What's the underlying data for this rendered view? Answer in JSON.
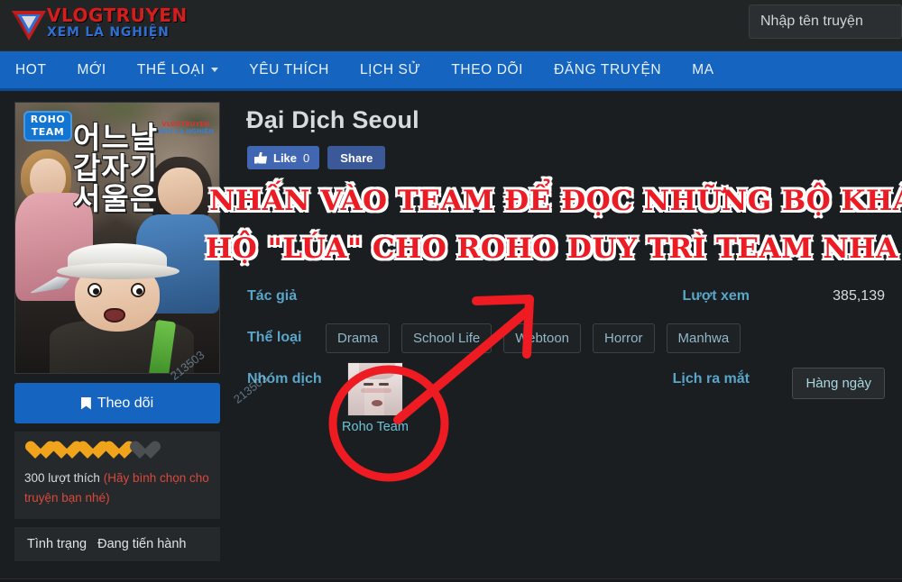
{
  "header": {
    "logo": {
      "line1": "VLOGTRUYEN",
      "line2": "XEM LÀ NGHIỆN",
      "icon": "triangle-play-logo-icon"
    },
    "search": {
      "placeholder": "Nhập tên truyện",
      "value": ""
    }
  },
  "nav": {
    "items": [
      {
        "label": "HOT",
        "has_caret": false
      },
      {
        "label": "MỚI",
        "has_caret": false
      },
      {
        "label": "THỂ LOẠI",
        "has_caret": true
      },
      {
        "label": "YÊU THÍCH",
        "has_caret": false
      },
      {
        "label": "LỊCH SỬ",
        "has_caret": false
      },
      {
        "label": "THEO DÕI",
        "has_caret": false
      },
      {
        "label": "ĐĂNG TRUYỆN",
        "has_caret": false
      },
      {
        "label": "MA",
        "has_caret": false
      }
    ]
  },
  "cover": {
    "team_badge_line1": "ROHO",
    "team_badge_line2": "TEAM",
    "korean_title": "어느날 갑자기 서울은",
    "watermark_line1": "VLOGTRUYEN",
    "watermark_line2": "XEM LÀ NGHIỆN"
  },
  "sidebar": {
    "follow_label": "Theo dõi",
    "follow_icon": "bookmark-icon",
    "hearts_filled": 4,
    "hearts_total": 5,
    "likes_text": "300 lượt thích",
    "likes_note": "(Hãy bình chọn cho truyện bạn nhé)",
    "status_label": "Tình trạng",
    "status_value": "Đang tiến hành"
  },
  "main": {
    "title": "Đại Dịch Seoul",
    "social": {
      "like_label": "Like",
      "like_count": "0",
      "share_label": "Share",
      "like_icon": "thumbs-up-icon"
    },
    "info": {
      "author_label": "Tác giả",
      "author_value": "",
      "views_label": "Lượt xem",
      "views_value": "385,139",
      "genres_label": "Thể loại",
      "genres": [
        "Drama",
        "School Life",
        "Webtoon",
        "Horror",
        "Manhwa"
      ],
      "team_label": "Nhóm dịch",
      "team_name": "Roho Team",
      "schedule_label": "Lịch ra mắt",
      "schedule_value": "Hàng ngày"
    }
  },
  "annotation": {
    "line1": "NHẤN VÀO TEAM ĐỂ ĐỌC NHỮNG BỘ KHÁC ỦNG",
    "line2": "HỘ \"LÚA\" CHO ROHO DUY TRÌ TEAM NHA CẢ NHÀ!!",
    "color": "#ec1c24",
    "shapes": [
      "circle-highlight",
      "arrow-pointer"
    ]
  },
  "watermarks": {
    "w1": "213503",
    "w2": "213503"
  },
  "colors": {
    "nav_blue": "#1565c0",
    "page_bg": "#1b1e20",
    "label_blue": "#58a6c9",
    "accent_red": "#ec1c24",
    "heart_orange": "#f0a41b"
  }
}
